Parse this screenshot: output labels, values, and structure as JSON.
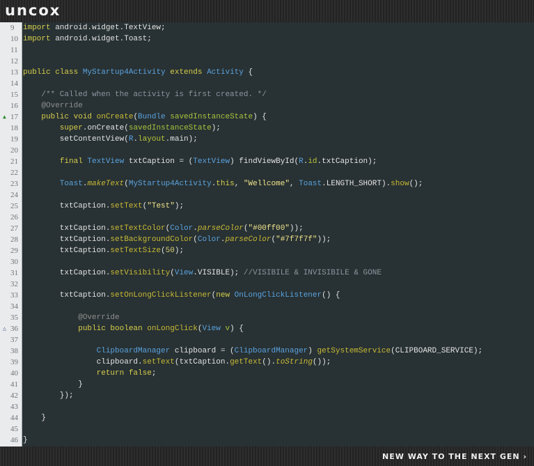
{
  "header": {
    "logo": "uncox"
  },
  "footer": {
    "tagline": "NEW WAY TO THE NEXT GEN ›"
  },
  "editor": {
    "lines": [
      {
        "n": "9",
        "tokens": [
          [
            "k",
            "import"
          ],
          [
            "t",
            " android.widget.TextView;"
          ]
        ]
      },
      {
        "n": "10",
        "tokens": [
          [
            "k",
            "import"
          ],
          [
            "t",
            " android.widget.Toast;"
          ]
        ]
      },
      {
        "n": "11",
        "tokens": []
      },
      {
        "n": "12",
        "tokens": []
      },
      {
        "n": "13",
        "tokens": [
          [
            "k",
            "public class "
          ],
          [
            "ty",
            "MyStartup4Activity"
          ],
          [
            "k",
            " extends "
          ],
          [
            "ty",
            "Activity"
          ],
          [
            "t",
            " {"
          ]
        ]
      },
      {
        "n": "14",
        "tokens": []
      },
      {
        "n": "15",
        "tokens": [
          [
            "c",
            "    /** Called when the activity is first created. */"
          ]
        ]
      },
      {
        "n": "16",
        "tokens": [
          [
            "a",
            "    @Override"
          ]
        ]
      },
      {
        "n": "17",
        "marker": "▲",
        "markerClass": "up",
        "tokens": [
          [
            "k",
            "    public void "
          ],
          [
            "m",
            "onCreate"
          ],
          [
            "t",
            "("
          ],
          [
            "ty",
            "Bundle"
          ],
          [
            "v",
            " savedInstanceState"
          ],
          [
            "t",
            ") {"
          ]
        ]
      },
      {
        "n": "18",
        "tokens": [
          [
            "k",
            "        super"
          ],
          [
            "t",
            "."
          ],
          [
            "t",
            "onCreate("
          ],
          [
            "v",
            "savedInstanceState"
          ],
          [
            "t",
            ");"
          ]
        ]
      },
      {
        "n": "19",
        "tokens": [
          [
            "t",
            "        setContentView("
          ],
          [
            "ty",
            "R"
          ],
          [
            "t",
            "."
          ],
          [
            "ca",
            "layout"
          ],
          [
            "t",
            ".main);"
          ]
        ]
      },
      {
        "n": "20",
        "tokens": []
      },
      {
        "n": "21",
        "tokens": [
          [
            "k",
            "        final "
          ],
          [
            "ty",
            "TextView"
          ],
          [
            "t",
            " txtCaption = ("
          ],
          [
            "ty",
            "TextView"
          ],
          [
            "t",
            ") findViewById("
          ],
          [
            "ty",
            "R"
          ],
          [
            "t",
            "."
          ],
          [
            "ca",
            "id"
          ],
          [
            "t",
            ".txtCaption);"
          ]
        ]
      },
      {
        "n": "22",
        "tokens": []
      },
      {
        "n": "23",
        "tokens": [
          [
            "ty",
            "        Toast"
          ],
          [
            "t",
            "."
          ],
          [
            "mi",
            "makeText"
          ],
          [
            "t",
            "("
          ],
          [
            "ty",
            "MyStartup4Activity"
          ],
          [
            "t",
            "."
          ],
          [
            "k",
            "this"
          ],
          [
            "t",
            ", "
          ],
          [
            "s",
            "\"Wellcome\""
          ],
          [
            "t",
            ", "
          ],
          [
            "ty",
            "Toast"
          ],
          [
            "t",
            ".LENGTH_SHORT)."
          ],
          [
            "m",
            "show"
          ],
          [
            "t",
            "();"
          ]
        ]
      },
      {
        "n": "24",
        "tokens": []
      },
      {
        "n": "25",
        "tokens": [
          [
            "t",
            "        txtCaption."
          ],
          [
            "m",
            "setText"
          ],
          [
            "t",
            "("
          ],
          [
            "s",
            "\"Test\""
          ],
          [
            "t",
            ");"
          ]
        ]
      },
      {
        "n": "26",
        "tokens": []
      },
      {
        "n": "27",
        "tokens": [
          [
            "t",
            "        txtCaption."
          ],
          [
            "m",
            "setTextColor"
          ],
          [
            "t",
            "("
          ],
          [
            "ty",
            "Color"
          ],
          [
            "t",
            "."
          ],
          [
            "mi",
            "parseColor"
          ],
          [
            "t",
            "("
          ],
          [
            "s",
            "\"#00ff00\""
          ],
          [
            "t",
            "));"
          ]
        ]
      },
      {
        "n": "28",
        "tokens": [
          [
            "t",
            "        txtCaption."
          ],
          [
            "m",
            "setBackgroundColor"
          ],
          [
            "t",
            "("
          ],
          [
            "ty",
            "Color"
          ],
          [
            "t",
            "."
          ],
          [
            "mi",
            "parseColor"
          ],
          [
            "t",
            "("
          ],
          [
            "s",
            "\"#7f7f7f\""
          ],
          [
            "t",
            "));"
          ]
        ]
      },
      {
        "n": "29",
        "tokens": [
          [
            "t",
            "        txtCaption."
          ],
          [
            "m",
            "setTextSize"
          ],
          [
            "t",
            "("
          ],
          [
            "p",
            "50"
          ],
          [
            "t",
            ");"
          ]
        ]
      },
      {
        "n": "30",
        "tokens": []
      },
      {
        "n": "31",
        "tokens": [
          [
            "t",
            "        txtCaption."
          ],
          [
            "m",
            "setVisibility"
          ],
          [
            "t",
            "("
          ],
          [
            "ty",
            "View"
          ],
          [
            "t",
            ".VISIBLE); "
          ],
          [
            "c",
            "//VISIBILE & INVISIBILE & GONE"
          ]
        ]
      },
      {
        "n": "32",
        "tokens": []
      },
      {
        "n": "33",
        "tokens": [
          [
            "t",
            "        txtCaption."
          ],
          [
            "m",
            "setOnLongClickListener"
          ],
          [
            "t",
            "("
          ],
          [
            "k",
            "new "
          ],
          [
            "ty",
            "OnLongClickListener"
          ],
          [
            "t",
            "() {"
          ]
        ]
      },
      {
        "n": "34",
        "tokens": []
      },
      {
        "n": "35",
        "tokens": [
          [
            "a",
            "            @Override"
          ]
        ]
      },
      {
        "n": "36",
        "marker": "△",
        "markerClass": "down",
        "tokens": [
          [
            "k",
            "            public boolean "
          ],
          [
            "m",
            "onLongClick"
          ],
          [
            "t",
            "("
          ],
          [
            "ty",
            "View"
          ],
          [
            "v",
            " v"
          ],
          [
            "t",
            ") {"
          ]
        ]
      },
      {
        "n": "37",
        "tokens": []
      },
      {
        "n": "38",
        "tokens": [
          [
            "ty",
            "                ClipboardManager"
          ],
          [
            "t",
            " clipboard = ("
          ],
          [
            "ty",
            "ClipboardManager"
          ],
          [
            "t",
            ") "
          ],
          [
            "m",
            "getSystemService"
          ],
          [
            "t",
            "(CLIPBOARD_SERVICE);"
          ]
        ]
      },
      {
        "n": "39",
        "tokens": [
          [
            "t",
            "                clipboard."
          ],
          [
            "m",
            "setText"
          ],
          [
            "t",
            "(txtCaption."
          ],
          [
            "m",
            "getText"
          ],
          [
            "t",
            "()."
          ],
          [
            "mi",
            "toString"
          ],
          [
            "t",
            "());"
          ]
        ]
      },
      {
        "n": "40",
        "tokens": [
          [
            "k",
            "                return false"
          ],
          [
            "t",
            ";"
          ]
        ]
      },
      {
        "n": "41",
        "tokens": [
          [
            "t",
            "            }"
          ]
        ]
      },
      {
        "n": "42",
        "tokens": [
          [
            "t",
            "        });"
          ]
        ]
      },
      {
        "n": "43",
        "tokens": []
      },
      {
        "n": "44",
        "tokens": [
          [
            "t",
            "    }"
          ]
        ]
      },
      {
        "n": "45",
        "tokens": []
      },
      {
        "n": "46",
        "tokens": [
          [
            "t",
            "}"
          ]
        ]
      }
    ]
  }
}
